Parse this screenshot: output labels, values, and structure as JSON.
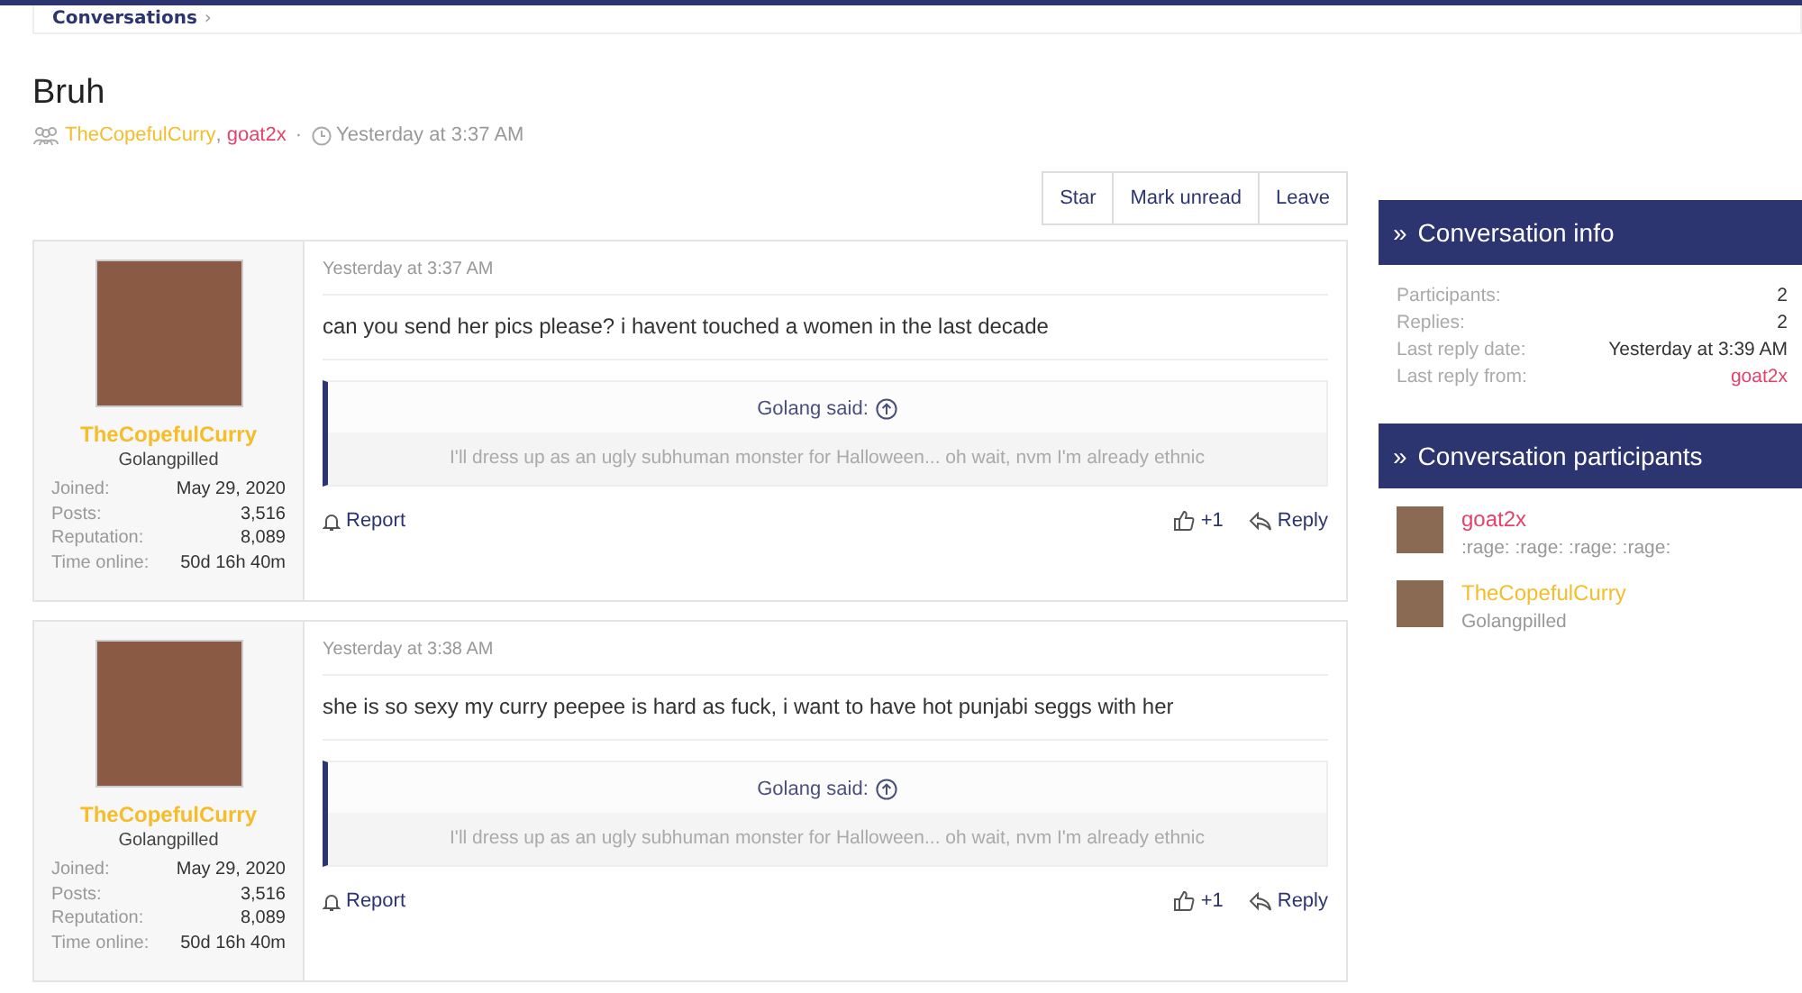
{
  "breadcrumb": {
    "label": "Conversations",
    "separator": "›"
  },
  "title": "Bruh",
  "meta": {
    "participants": [
      {
        "name": "TheCopefulCurry",
        "color": "#f5bd2a"
      },
      {
        "name": "goat2x",
        "color": "#e5416b"
      }
    ],
    "separator": ",",
    "dot": "·",
    "time": "Yesterday at 3:37 AM"
  },
  "actions": [
    "Star",
    "Mark unread",
    "Leave"
  ],
  "posts": [
    {
      "author": {
        "name": "TheCopefulCurry",
        "color": "#f5bd2a"
      },
      "title": "Golangpilled",
      "stats": [
        {
          "label": "Joined:",
          "value": "May 29, 2020"
        },
        {
          "label": "Posts:",
          "value": "3,516"
        },
        {
          "label": "Reputation:",
          "value": "8,089"
        },
        {
          "label": "Time online:",
          "value": "50d 16h 40m"
        }
      ],
      "time": "Yesterday at 3:37 AM",
      "body": "can you send her pics please? i havent touched a women in the last decade",
      "quote": {
        "author": "Golang said:",
        "text": "I'll dress up as an ugly subhuman monster for Halloween... oh wait, nvm I'm already ethnic"
      },
      "report": "Report",
      "likes": "+1",
      "reply": "Reply"
    },
    {
      "author": {
        "name": "TheCopefulCurry",
        "color": "#f5bd2a"
      },
      "title": "Golangpilled",
      "stats": [
        {
          "label": "Joined:",
          "value": "May 29, 2020"
        },
        {
          "label": "Posts:",
          "value": "3,516"
        },
        {
          "label": "Reputation:",
          "value": "8,089"
        },
        {
          "label": "Time online:",
          "value": "50d 16h 40m"
        }
      ],
      "time": "Yesterday at 3:38 AM",
      "body": "she is so sexy my curry peepee is hard as fuck, i want to have hot punjabi seggs with her",
      "quote": {
        "author": "Golang said:",
        "text": "I'll dress up as an ugly subhuman monster for Halloween... oh wait, nvm I'm already ethnic"
      },
      "report": "Report",
      "likes": "+1",
      "reply": "Reply"
    }
  ],
  "sidebar": {
    "info": {
      "marker": "»",
      "title": "Conversation info",
      "rows": [
        {
          "label": "Participants:",
          "value": "2",
          "color": "#333333"
        },
        {
          "label": "Replies:",
          "value": "2",
          "color": "#333333"
        },
        {
          "label": "Last reply date:",
          "value": "Yesterday at 3:39 AM",
          "color": "#333333"
        },
        {
          "label": "Last reply from:",
          "value": "goat2x",
          "color": "#e5416b"
        }
      ]
    },
    "participants": {
      "marker": "»",
      "title": "Conversation participants",
      "items": [
        {
          "name": "goat2x",
          "color": "#e5416b",
          "subtitle": ":rage: :rage: :rage: :rage:"
        },
        {
          "name": "TheCopefulCurry",
          "color": "#f5bd2a",
          "subtitle": "Golangpilled"
        }
      ]
    }
  }
}
